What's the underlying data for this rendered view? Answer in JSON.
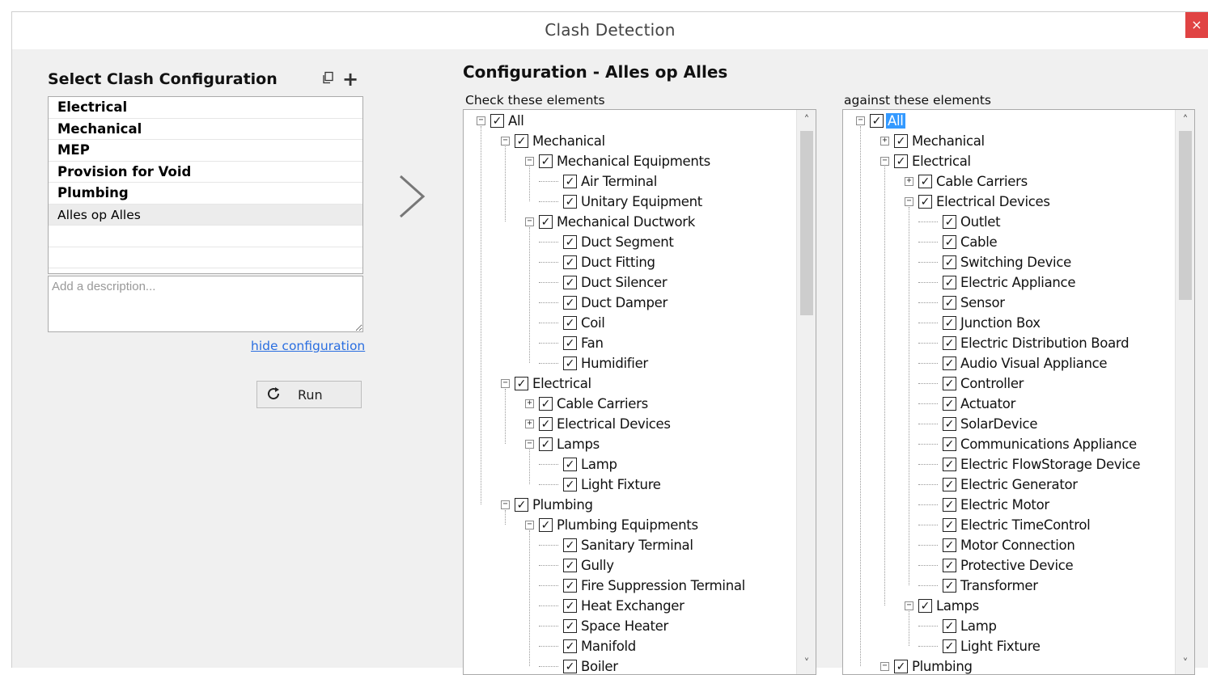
{
  "window": {
    "title": "Clash Detection",
    "close_label": "×"
  },
  "left": {
    "heading": "Select Clash Configuration",
    "copy_icon": "copy-icon",
    "add_icon": "+",
    "configs": [
      {
        "label": "Electrical",
        "bold": true
      },
      {
        "label": "Mechanical",
        "bold": true
      },
      {
        "label": "MEP",
        "bold": true
      },
      {
        "label": "Provision for Void",
        "bold": true
      },
      {
        "label": "Plumbing",
        "bold": true
      },
      {
        "label": "Alles op Alles",
        "bold": false,
        "selected": true
      },
      {
        "label": "",
        "bold": false
      },
      {
        "label": "",
        "bold": false
      }
    ],
    "description_placeholder": "Add a description...",
    "hide_link": "hide configuration",
    "run_label": "Run"
  },
  "config": {
    "heading": "Configuration - Alles op Alles",
    "left_caption": "Check these elements",
    "right_caption": "against these elements"
  },
  "left_tree": [
    {
      "label": "All",
      "level": 0,
      "expander": "minus",
      "checked": true
    },
    {
      "label": "Mechanical",
      "level": 1,
      "expander": "minus",
      "checked": true
    },
    {
      "label": "Mechanical Equipments",
      "level": 2,
      "expander": "minus",
      "checked": true
    },
    {
      "label": "Air Terminal",
      "level": 3,
      "expander": "none",
      "checked": true
    },
    {
      "label": "Unitary Equipment",
      "level": 3,
      "expander": "none",
      "checked": true
    },
    {
      "label": "Mechanical Ductwork",
      "level": 2,
      "expander": "minus",
      "checked": true
    },
    {
      "label": "Duct Segment",
      "level": 3,
      "expander": "none",
      "checked": true
    },
    {
      "label": "Duct Fitting",
      "level": 3,
      "expander": "none",
      "checked": true
    },
    {
      "label": "Duct Silencer",
      "level": 3,
      "expander": "none",
      "checked": true
    },
    {
      "label": "Duct Damper",
      "level": 3,
      "expander": "none",
      "checked": true
    },
    {
      "label": "Coil",
      "level": 3,
      "expander": "none",
      "checked": true
    },
    {
      "label": "Fan",
      "level": 3,
      "expander": "none",
      "checked": true
    },
    {
      "label": "Humidifier",
      "level": 3,
      "expander": "none",
      "checked": true
    },
    {
      "label": "Electrical",
      "level": 1,
      "expander": "minus",
      "checked": true
    },
    {
      "label": "Cable Carriers",
      "level": 2,
      "expander": "plus",
      "checked": true
    },
    {
      "label": "Electrical Devices",
      "level": 2,
      "expander": "plus",
      "checked": true
    },
    {
      "label": "Lamps",
      "level": 2,
      "expander": "minus",
      "checked": true
    },
    {
      "label": "Lamp",
      "level": 3,
      "expander": "none",
      "checked": true
    },
    {
      "label": "Light Fixture",
      "level": 3,
      "expander": "none",
      "checked": true
    },
    {
      "label": "Plumbing",
      "level": 1,
      "expander": "minus",
      "checked": true
    },
    {
      "label": "Plumbing Equipments",
      "level": 2,
      "expander": "minus",
      "checked": true
    },
    {
      "label": "Sanitary Terminal",
      "level": 3,
      "expander": "none",
      "checked": true
    },
    {
      "label": "Gully",
      "level": 3,
      "expander": "none",
      "checked": true
    },
    {
      "label": "Fire Suppression Terminal",
      "level": 3,
      "expander": "none",
      "checked": true
    },
    {
      "label": "Heat Exchanger",
      "level": 3,
      "expander": "none",
      "checked": true
    },
    {
      "label": "Space Heater",
      "level": 3,
      "expander": "none",
      "checked": true
    },
    {
      "label": "Manifold",
      "level": 3,
      "expander": "none",
      "checked": true
    },
    {
      "label": "Boiler",
      "level": 3,
      "expander": "none",
      "checked": true
    }
  ],
  "right_tree": [
    {
      "label": "All",
      "level": 0,
      "expander": "minus",
      "checked": true,
      "selected": true
    },
    {
      "label": "Mechanical",
      "level": 1,
      "expander": "plus",
      "checked": true
    },
    {
      "label": "Electrical",
      "level": 1,
      "expander": "minus",
      "checked": true
    },
    {
      "label": "Cable Carriers",
      "level": 2,
      "expander": "plus",
      "checked": true
    },
    {
      "label": "Electrical Devices",
      "level": 2,
      "expander": "minus",
      "checked": true
    },
    {
      "label": "Outlet",
      "level": 3,
      "expander": "none",
      "checked": true
    },
    {
      "label": "Cable",
      "level": 3,
      "expander": "none",
      "checked": true
    },
    {
      "label": "Switching Device",
      "level": 3,
      "expander": "none",
      "checked": true
    },
    {
      "label": "Electric Appliance",
      "level": 3,
      "expander": "none",
      "checked": true
    },
    {
      "label": "Sensor",
      "level": 3,
      "expander": "none",
      "checked": true
    },
    {
      "label": "Junction Box",
      "level": 3,
      "expander": "none",
      "checked": true
    },
    {
      "label": "Electric Distribution Board",
      "level": 3,
      "expander": "none",
      "checked": true
    },
    {
      "label": "Audio Visual Appliance",
      "level": 3,
      "expander": "none",
      "checked": true
    },
    {
      "label": "Controller",
      "level": 3,
      "expander": "none",
      "checked": true
    },
    {
      "label": "Actuator",
      "level": 3,
      "expander": "none",
      "checked": true
    },
    {
      "label": "SolarDevice",
      "level": 3,
      "expander": "none",
      "checked": true
    },
    {
      "label": "Communications Appliance",
      "level": 3,
      "expander": "none",
      "checked": true
    },
    {
      "label": "Electric FlowStorage Device",
      "level": 3,
      "expander": "none",
      "checked": true
    },
    {
      "label": "Electric Generator",
      "level": 3,
      "expander": "none",
      "checked": true
    },
    {
      "label": "Electric Motor",
      "level": 3,
      "expander": "none",
      "checked": true
    },
    {
      "label": "Electric TimeControl",
      "level": 3,
      "expander": "none",
      "checked": true
    },
    {
      "label": "Motor Connection",
      "level": 3,
      "expander": "none",
      "checked": true
    },
    {
      "label": "Protective Device",
      "level": 3,
      "expander": "none",
      "checked": true
    },
    {
      "label": "Transformer",
      "level": 3,
      "expander": "none",
      "checked": true
    },
    {
      "label": "Lamps",
      "level": 2,
      "expander": "minus",
      "checked": true
    },
    {
      "label": "Lamp",
      "level": 3,
      "expander": "none",
      "checked": true
    },
    {
      "label": "Light Fixture",
      "level": 3,
      "expander": "none",
      "checked": true
    },
    {
      "label": "Plumbing",
      "level": 1,
      "expander": "minus",
      "checked": true
    }
  ],
  "scroll": {
    "left_position": 0.0,
    "left_visible": 0.35,
    "right_position": 0.0,
    "right_visible": 0.32
  },
  "colors": {
    "selection": "#3399ff",
    "link": "#2a6ee0",
    "close": "#e04343"
  }
}
